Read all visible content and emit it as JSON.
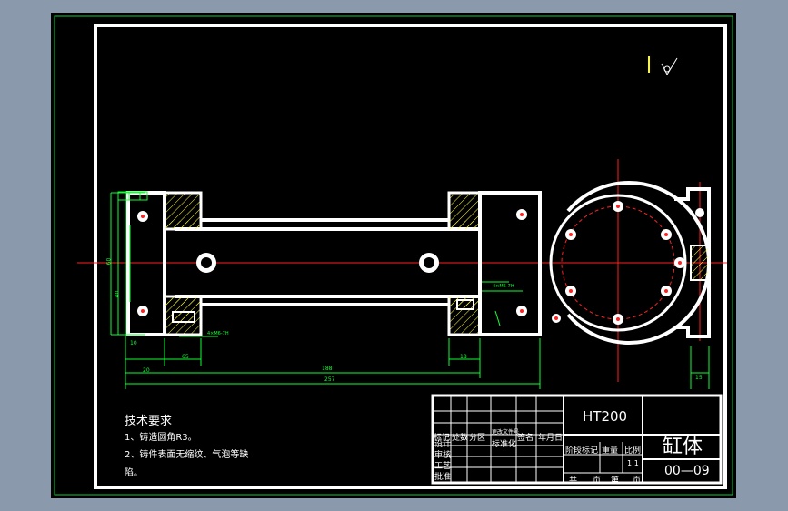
{
  "technical_requirements": {
    "title": "技术要求",
    "line1": "1、铸造圆角R3。",
    "line2a": "2、铸件表面无缩纹、气泡等缺",
    "line2b": "陷。"
  },
  "title_block": {
    "material": "HT200",
    "part_name": "缸体",
    "drawing_number": "00—09",
    "scale": "1:1",
    "header_cells": [
      "标记",
      "处数",
      "分区",
      "更改文件号",
      "签名",
      "年月日"
    ],
    "row_labels": [
      "设计",
      "审核",
      "工艺",
      "标准化",
      "批准"
    ],
    "stage_labels": [
      "阶段标记",
      "重量",
      "比例"
    ],
    "sheet_labels": [
      "共",
      "页",
      "第",
      "页"
    ]
  },
  "dimensions": {
    "length_188": "188",
    "length_257": "257",
    "d_20": "20",
    "d_65": "65",
    "d_10": "10",
    "d_18": "18",
    "d_15": "15",
    "d_60": "60",
    "d_40": "40",
    "thread_left": "4×M6-7H",
    "thread_right": "4×M6-7H"
  },
  "colors": {
    "background": "#000000",
    "outline": "#ffffff",
    "dimension": "#00ff00",
    "centerline": "#ff0000",
    "hatch": "#ffff00",
    "canvas": "#8a99ab"
  }
}
